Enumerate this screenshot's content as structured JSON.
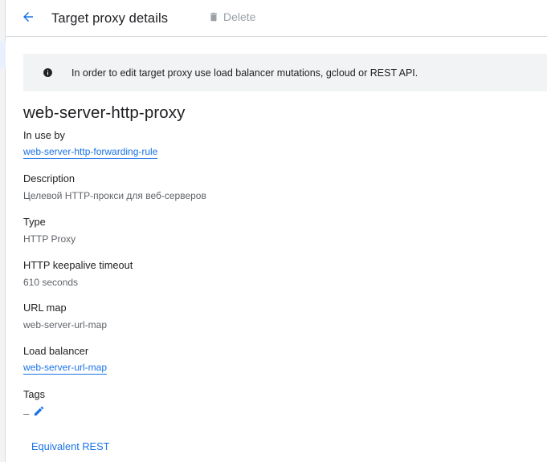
{
  "header": {
    "back_icon": "arrow-back-icon",
    "title": "Target proxy details",
    "delete_label": "Delete",
    "delete_icon": "trash-icon"
  },
  "banner": {
    "icon": "info-icon",
    "text": "In order to edit target proxy use load balancer mutations, gcloud or REST API."
  },
  "resource_name": "web-server-http-proxy",
  "fields": {
    "in_use_by": {
      "label": "In use by",
      "value": "web-server-http-forwarding-rule"
    },
    "description": {
      "label": "Description",
      "value": "Целевой HTTP-прокси для веб-серверов"
    },
    "type": {
      "label": "Type",
      "value": "HTTP Proxy"
    },
    "keepalive": {
      "label": "HTTP keepalive timeout",
      "value": "610 seconds"
    },
    "url_map": {
      "label": "URL map",
      "value": "web-server-url-map"
    },
    "load_balancer": {
      "label": "Load balancer",
      "value": "web-server-url-map"
    },
    "tags": {
      "label": "Tags",
      "value": "–",
      "edit_icon": "pencil-icon"
    }
  },
  "equivalent_rest_label": "Equivalent REST",
  "colors": {
    "accent": "#1a73e8",
    "disabled": "#9aa0a6",
    "banner_bg": "#f1f3f4",
    "secondary_text": "#5f6368"
  }
}
